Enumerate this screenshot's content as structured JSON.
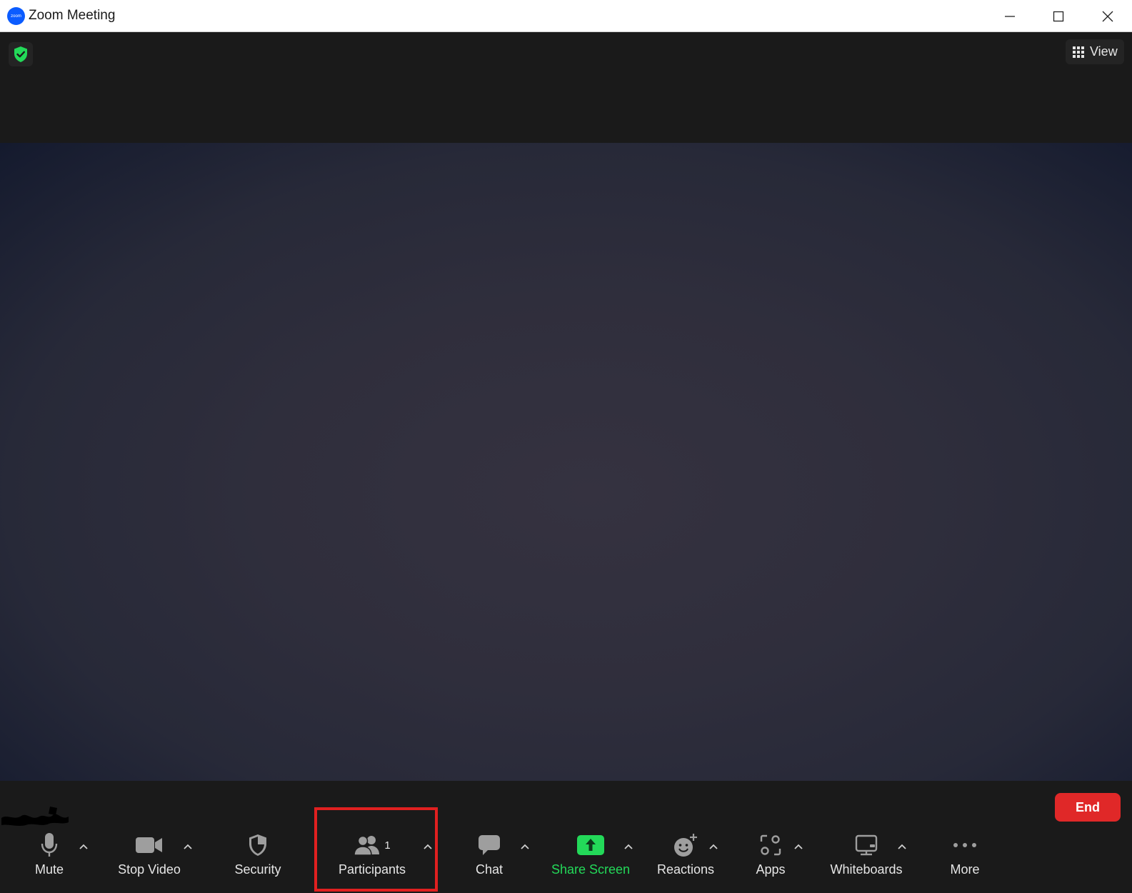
{
  "window": {
    "title": "Zoom Meeting",
    "logo_text": "zoom"
  },
  "header": {
    "view_label": "View"
  },
  "toolbar": {
    "mute_label": "Mute",
    "stop_video_label": "Stop Video",
    "security_label": "Security",
    "participants_label": "Participants",
    "participants_count": "1",
    "chat_label": "Chat",
    "share_screen_label": "Share Screen",
    "reactions_label": "Reactions",
    "apps_label": "Apps",
    "whiteboards_label": "Whiteboards",
    "more_label": "More",
    "end_label": "End"
  },
  "colors": {
    "accent_green": "#23d959",
    "end_red": "#e02828",
    "highlight_red": "#e02020",
    "zoom_blue": "#0b5cff"
  }
}
